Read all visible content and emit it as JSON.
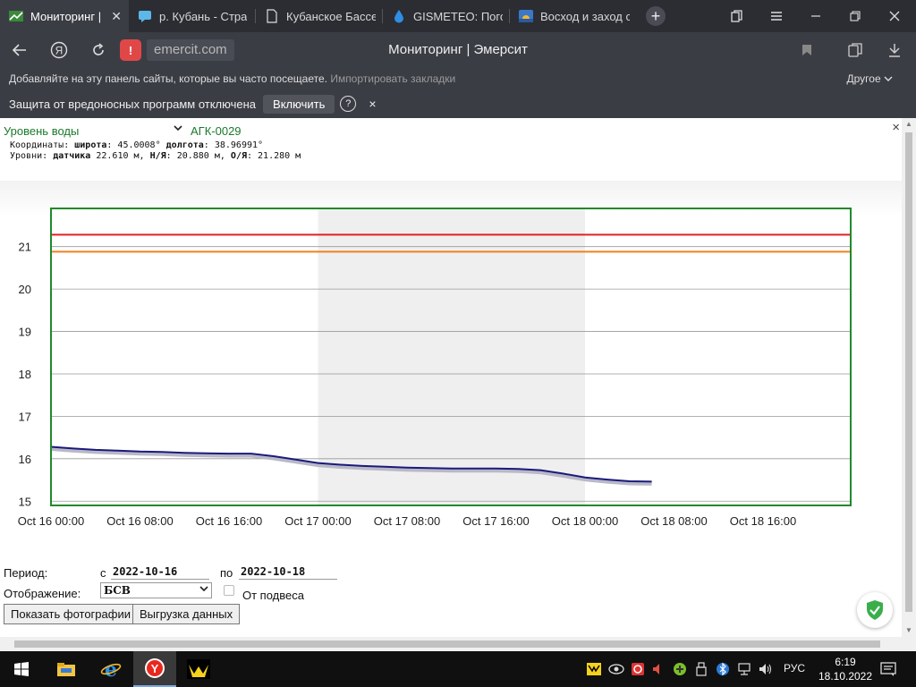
{
  "browser": {
    "tabs": [
      {
        "title": "Мониторинг | Эм",
        "icon": "monitoring-icon",
        "active": true
      },
      {
        "title": "р. Кубань - Стра",
        "icon": "chat-icon"
      },
      {
        "title": "Кубанское Бассе",
        "icon": "document-icon"
      },
      {
        "title": "GISMETEO: Пого",
        "icon": "water-drop-icon"
      },
      {
        "title": "Восход и заход с",
        "icon": "sunrise-icon"
      }
    ],
    "new_tab": "+",
    "url": "emercit.com",
    "page_title": "Мониторинг | Эмерсит",
    "bookmarks_hint": "Добавляйте на эту панель сайты, которые вы часто посещаете.",
    "bookmarks_import": "Импортировать закладки",
    "bookmarks_other": "Другое",
    "protection_text": "Защита от вредоносных программ отключена",
    "protection_button": "Включить",
    "protection_help": "?",
    "protection_close": "×"
  },
  "panel": {
    "parameter": "Уровень воды",
    "station": "АГК-0029",
    "coords_label": "Координаты:",
    "lat_label": "широта",
    "lat_value": ": 45.0008°",
    "lon_label": "долгота",
    "lon_value": ": 38.96991°",
    "levels_label": "Уровни:",
    "sensor_label": "датчика",
    "sensor_value": " 22.610 м,",
    "ny_label": "Н/Я",
    "ny_value": ": 20.880 м,",
    "oy_label": "О/Я",
    "oy_value": ": 21.280 м",
    "close": "×"
  },
  "chart_data": {
    "type": "line",
    "x_tick_labels": [
      "Oct 16 00:00",
      "Oct 16 08:00",
      "Oct 16 16:00",
      "Oct 17 00:00",
      "Oct 17 08:00",
      "Oct 17 16:00",
      "Oct 18 00:00",
      "Oct 18 08:00",
      "Oct 18 16:00"
    ],
    "y_tick_labels": [
      "15",
      "16",
      "17",
      "18",
      "19",
      "20",
      "21"
    ],
    "ylim": [
      14.9,
      21.9
    ],
    "xlim_hours": [
      0,
      72
    ],
    "shaded_x_hours": [
      24,
      48
    ],
    "thresholds": [
      {
        "value": 21.28,
        "color": "#e02020"
      },
      {
        "value": 20.88,
        "color": "#f08020"
      }
    ],
    "series": [
      {
        "color": "#1a1a7a",
        "x_hours": [
          0,
          2,
          4,
          6,
          8,
          10,
          12,
          14,
          16,
          18,
          20,
          22,
          24,
          26,
          28,
          30,
          32,
          34,
          36,
          38,
          40,
          42,
          44,
          46,
          48,
          50,
          52,
          54
        ],
        "values": [
          16.28,
          16.24,
          16.21,
          16.19,
          16.17,
          16.16,
          16.14,
          16.13,
          16.12,
          16.12,
          16.06,
          15.98,
          15.9,
          15.86,
          15.83,
          15.81,
          15.79,
          15.78,
          15.77,
          15.77,
          15.77,
          15.76,
          15.73,
          15.65,
          15.56,
          15.51,
          15.47,
          15.46
        ]
      }
    ]
  },
  "form": {
    "period_label": "Период:",
    "from_label": "с",
    "from_value": "2022-10-16",
    "to_label": "по",
    "to_value": "2022-10-18",
    "display_label": "Отображение:",
    "display_value": "БСВ",
    "suspension_label": "От подвеса",
    "photos_button": "Показать фотографии",
    "export_button": "Выгрузка данных"
  },
  "taskbar": {
    "lang": "РУС",
    "time": "6:19",
    "date": "18.10.2022"
  }
}
